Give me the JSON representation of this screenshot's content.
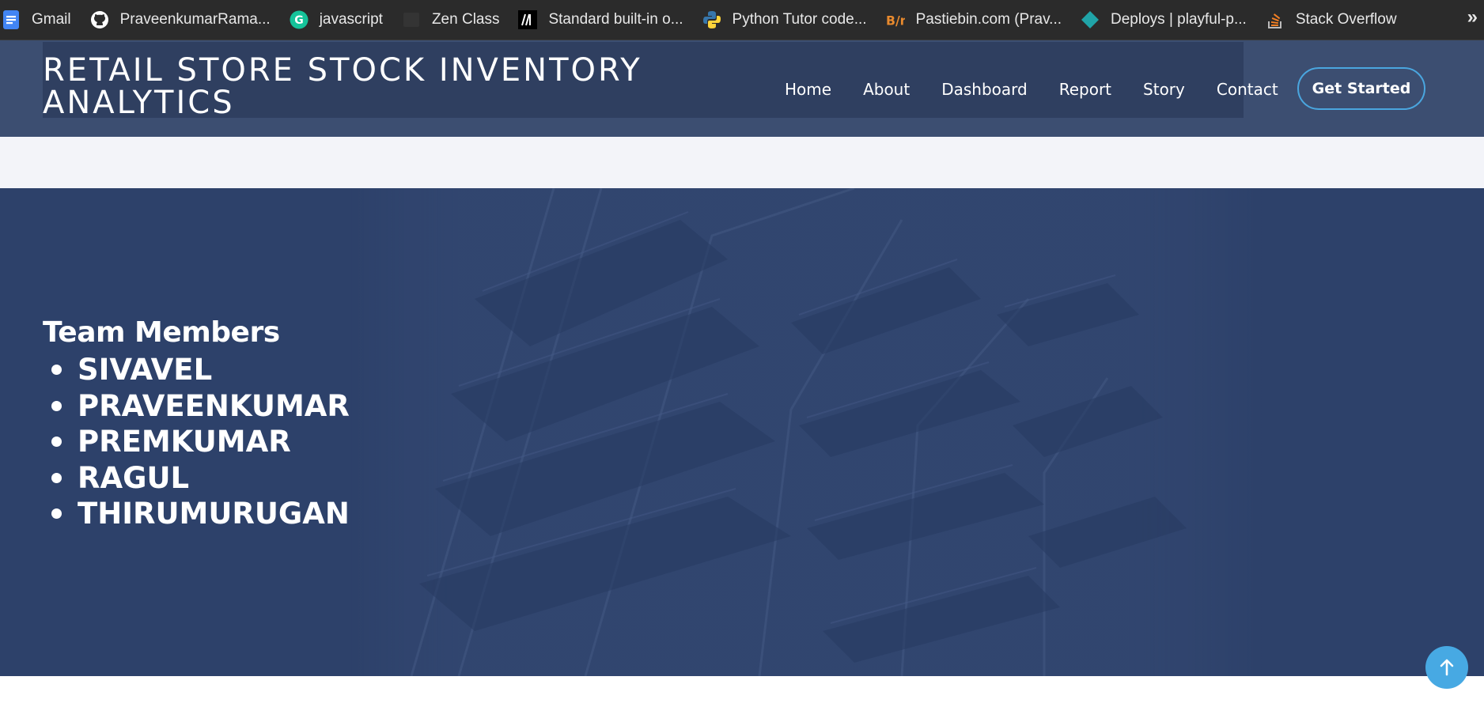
{
  "bookmarks": [
    {
      "icon": "google-docs-icon",
      "label": "Gmail",
      "color": "#4285f4"
    },
    {
      "icon": "github-icon",
      "label": "PraveenkumarRama...",
      "color": "#ffffff"
    },
    {
      "icon": "grammarly-icon",
      "label": "javascript",
      "color": "#15c39a"
    },
    {
      "icon": "zen-class-icon",
      "label": "Zen Class",
      "color": "#333333"
    },
    {
      "icon": "mdn-icon",
      "label": "Standard built-in o...",
      "color": "#000000"
    },
    {
      "icon": "python-icon",
      "label": "Python Tutor code...",
      "color": "#3776ab"
    },
    {
      "icon": "pastebin-icon",
      "label": "Pastiebin.com (Prav...",
      "color": "#e88a2e"
    },
    {
      "icon": "netlify-icon",
      "label": "Deploys | playful-p...",
      "color": "#20a4a8"
    },
    {
      "icon": "stackoverflow-icon",
      "label": "Stack Overflow",
      "color": "#f48024"
    }
  ],
  "bookmarks_more": "»",
  "header": {
    "title": "RETAIL STORE STOCK INVENTORY ANALYTICS",
    "nav": [
      "Home",
      "About",
      "Dashboard",
      "Report",
      "Story",
      "Contact"
    ],
    "cta_label": "Get Started",
    "accent": "#4aa6df"
  },
  "hero": {
    "heading": "Team Members",
    "members": [
      "SIVAVEL",
      "PRAVEENKUMAR",
      "PREMKUMAR",
      "RAGUL",
      "THIRUMURUGAN"
    ],
    "background": "#2d416a"
  },
  "scroll_top": {
    "icon": "arrow-up-icon",
    "color": "#47a9e3"
  }
}
